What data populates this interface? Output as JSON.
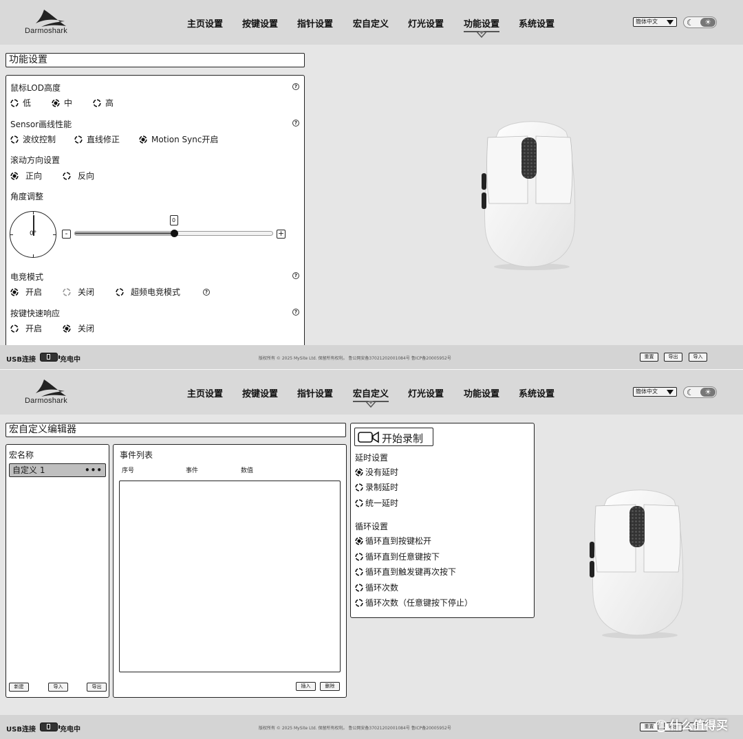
{
  "brand": {
    "name": "Darmoshark"
  },
  "nav": {
    "items": [
      "主页设置",
      "按键设置",
      "指针设置",
      "宏自定义",
      "灯光设置",
      "功能设置",
      "系统设置"
    ]
  },
  "lang": {
    "selected": "簡体中文"
  },
  "theme": {
    "moon_icon": "moon-icon",
    "sun_icon": "sun-icon",
    "moon_glyph": "☾",
    "sun_glyph": "☀"
  },
  "screen1": {
    "active_nav": "功能设置",
    "page_title": "功能设置",
    "lod": {
      "label": "鼠标LOD高度",
      "options": [
        "低",
        "中",
        "高"
      ],
      "selected": "中"
    },
    "sensor": {
      "label": "Sensor画线性能",
      "options": [
        "波纹控制",
        "直线修正",
        "Motion Sync开启"
      ],
      "selected": "Motion Sync开启"
    },
    "scroll": {
      "label": "滚动方向设置",
      "options": [
        "正向",
        "反向"
      ],
      "selected": "正向"
    },
    "angle": {
      "label": "角度调整",
      "value": "0",
      "dial_value": "0°",
      "minus": "-",
      "plus": "+",
      "slider_fraction": 0.5
    },
    "esports": {
      "label": "电竞模式",
      "options": [
        "开启",
        "关闭",
        "超频电竞模式"
      ],
      "selected": "开启"
    },
    "quick_response": {
      "label": "按键快速响应",
      "options": [
        "开启",
        "关闭"
      ],
      "selected": "关闭"
    }
  },
  "screen2": {
    "active_nav": "宏自定义",
    "editor_title": "宏自定义编辑器",
    "macro_list": {
      "header": "宏名称",
      "items": [
        "自定义 1"
      ],
      "more": "•••",
      "buttons": {
        "new": "新建",
        "import": "导入",
        "export": "导出"
      }
    },
    "events": {
      "header": "事件列表",
      "columns": [
        "序号",
        "事件",
        "数值"
      ],
      "buttons": {
        "insert": "插入",
        "delete": "删除"
      }
    },
    "record": {
      "button_label": "开始录制",
      "delay": {
        "label": "延时设置",
        "options": [
          "没有延时",
          "录制延时",
          "统一延时"
        ],
        "selected": "没有延时"
      },
      "loop": {
        "label": "循环设置",
        "options": [
          "循环直到按键松开",
          "循环直到任意键按下",
          "循环直到触发键再次按下",
          "循环次数",
          "循环次数（任意键按下停止）"
        ],
        "selected": "循环直到按键松开"
      }
    }
  },
  "footer": {
    "usb": "USB连接",
    "charging": "充电中",
    "copyright": "版权所有 © 2025 MySite Ltd. 保留所有权利。   鲁公网安备37021202001084号  鲁ICP备20005952号",
    "buttons": {
      "reset": "重置",
      "export": "导出",
      "import": "导入"
    }
  },
  "watermark": {
    "text": "什么值得买",
    "icon_glyph": "值"
  },
  "colors": {
    "header_bg": "#d9d9d9",
    "page_bg": "#e6e6e6",
    "footer_bg": "#d4d4d4",
    "macro_item_bg": "#bfbfbf"
  }
}
